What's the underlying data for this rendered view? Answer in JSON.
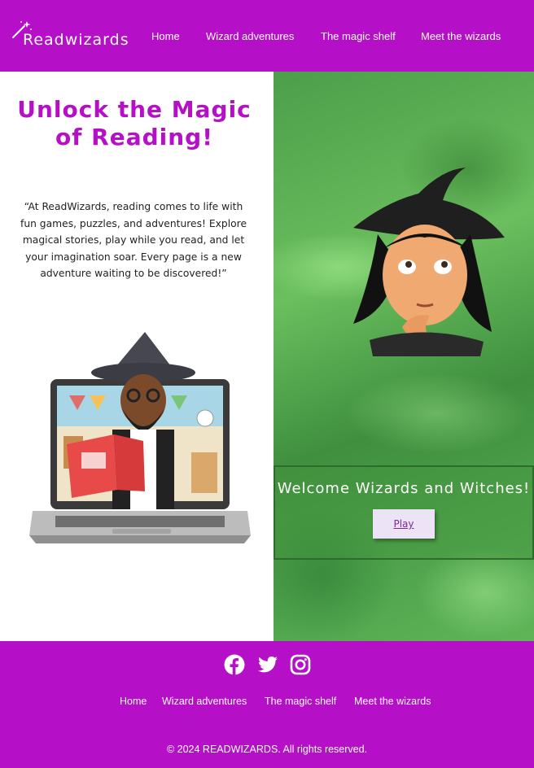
{
  "header": {
    "logo_text": "Readwizards",
    "nav": [
      {
        "label": "Home"
      },
      {
        "label": "Wizard adventures"
      },
      {
        "label": "The magic shelf"
      },
      {
        "label": "Meet the wizards"
      }
    ]
  },
  "hero": {
    "title": "Unlock the Magic of Reading!",
    "quote": "“At ReadWizards, reading comes to life with fun games, puzzles, and adventures! Explore magical stories, play while you read, and let your imagination soar. Every page is a new adventure waiting to be discovered!”"
  },
  "welcome": {
    "title": "Welcome Wizards and Witches!",
    "play_label": "Play"
  },
  "footer": {
    "social": [
      {
        "icon": "facebook-icon"
      },
      {
        "icon": "twitter-icon"
      },
      {
        "icon": "instagram-icon"
      }
    ],
    "nav": [
      {
        "label": "Home"
      },
      {
        "label": "Wizard adventures"
      },
      {
        "label": "The magic shelf"
      },
      {
        "label": "Meet the wizards"
      }
    ],
    "copyright": "© 2024 READWIZARDS. All rights reserved."
  },
  "colors": {
    "brand_purple": "#b50fc7",
    "hero_green": "#5aae52",
    "play_button_bg": "#ece4f6"
  }
}
